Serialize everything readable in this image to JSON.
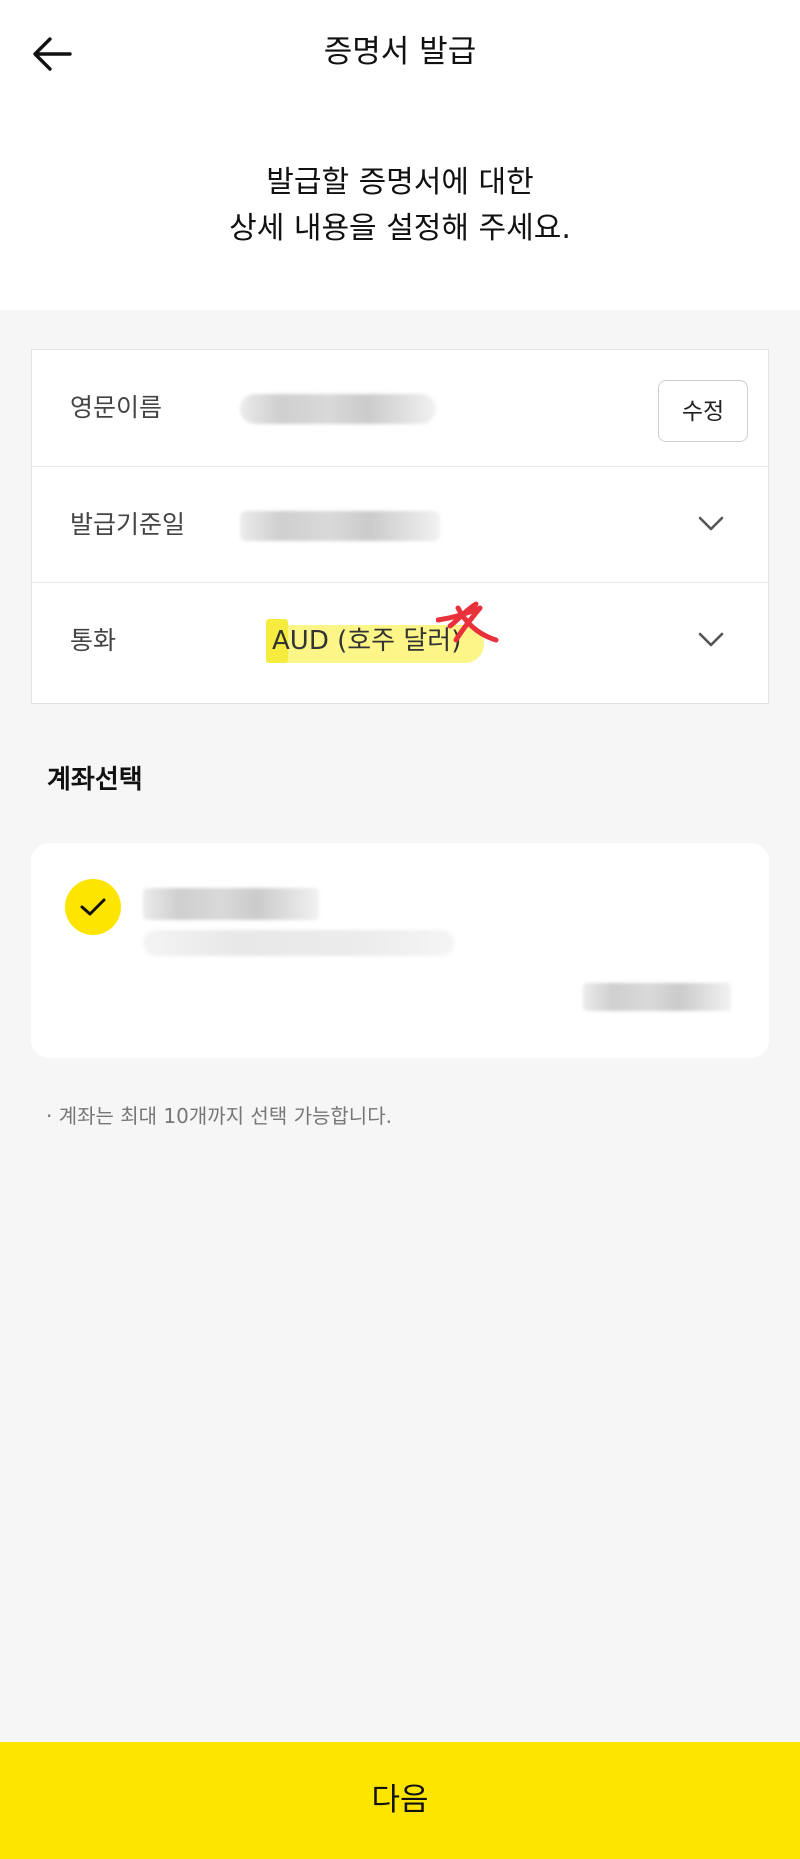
{
  "header": {
    "title": "증명서 발급",
    "back_icon": "arrow-left-icon"
  },
  "intro": {
    "line1": "발급할 증명서에 대한",
    "line2": "상세 내용을 설정해 주세요."
  },
  "settings": {
    "english_name": {
      "label": "영문이름",
      "edit_label": "수정"
    },
    "issue_date": {
      "label": "발급기준일"
    },
    "currency": {
      "label": "통화",
      "value": "AUD (호주 달러)"
    }
  },
  "account_section": {
    "title": "계좌선택",
    "note": "· 계좌는 최대 10개까지 선택 가능합니다."
  },
  "footer": {
    "next_label": "다음"
  },
  "colors": {
    "accent": "#FEE500",
    "highlight": "#FBF57A",
    "scribble": "#E8313A"
  }
}
